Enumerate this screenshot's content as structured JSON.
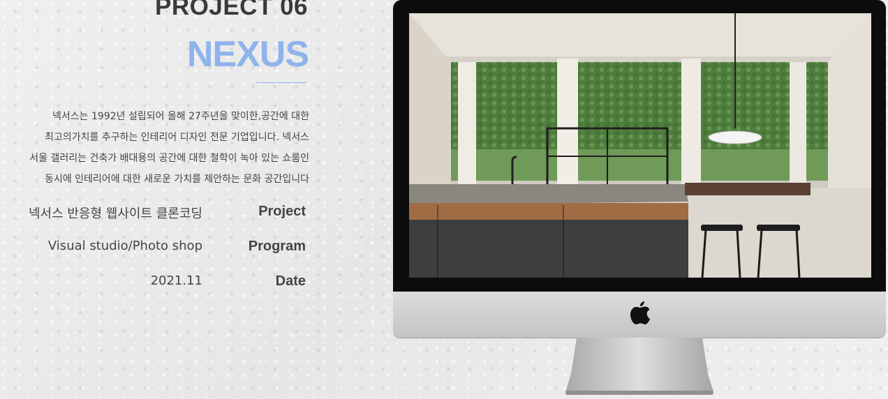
{
  "project": {
    "number": "PROJECT 06",
    "name": "NEXUS"
  },
  "description": [
    "넥서스는 1992년 설립되어 올해 27주년을 맞이한,공간에 대한",
    "최고의가치를 추구하는 인테리어 디자인 전문 기업입니다.  넥서스",
    "서울 갤러리는 건축가 배대용의 공간에 대한 철학이 녹아 있는 쇼룸인",
    "동시에 인테리어에 대한 새로운 가치를 제안하는 문화 공간입니다"
  ],
  "meta": [
    {
      "key": "Project",
      "value": "넥서스 반응형 웹사이트 클론코딩"
    },
    {
      "key": "Program",
      "value": "Visual studio/Photo shop"
    },
    {
      "key": "Date",
      "value": "2021.11"
    }
  ],
  "mockup": {
    "device": "imac",
    "logo": "apple-logo-icon",
    "screen_image": "modern kitchen interior with island, glass partition and garden view"
  },
  "colors": {
    "accent": "#8fb3ec",
    "text": "#444444",
    "heading": "#3a3a3a",
    "bezel": "#0c0c0c",
    "chin": "#d0d0d0"
  }
}
